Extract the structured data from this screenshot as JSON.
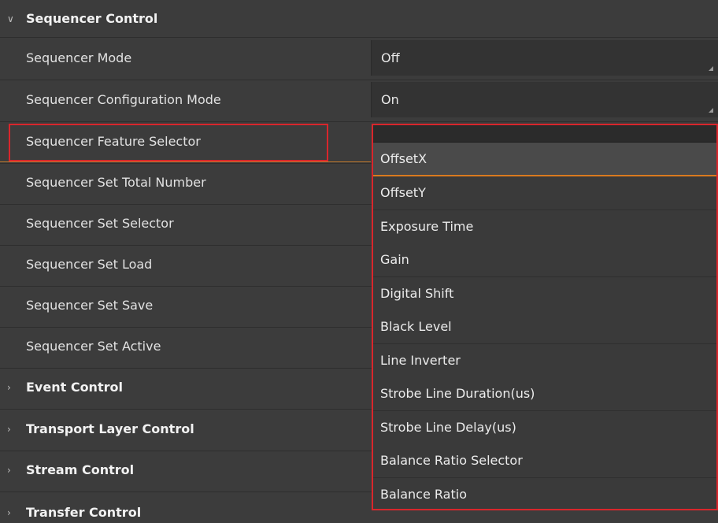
{
  "groups": {
    "sequencer_control": "Sequencer Control",
    "event_control": "Event Control",
    "transport_layer_control": "Transport Layer Control",
    "stream_control": "Stream Control",
    "transfer_control": "Transfer Control"
  },
  "properties": {
    "sequencer_mode": {
      "label": "Sequencer Mode",
      "value": "Off"
    },
    "sequencer_configuration_mode": {
      "label": "Sequencer Configuration Mode",
      "value": "On"
    },
    "sequencer_feature_selector": {
      "label": "Sequencer Feature Selector"
    },
    "sequencer_set_total_number": {
      "label": "Sequencer Set Total Number"
    },
    "sequencer_set_selector": {
      "label": "Sequencer Set Selector"
    },
    "sequencer_set_load": {
      "label": "Sequencer Set Load"
    },
    "sequencer_set_save": {
      "label": "Sequencer Set Save"
    },
    "sequencer_set_active": {
      "label": "Sequencer Set Active"
    }
  },
  "dropdown": {
    "selected": "OffsetX",
    "options": [
      "OffsetX",
      "OffsetY",
      "Exposure Time",
      "Gain",
      "Digital Shift",
      "Black Level",
      "Line Inverter",
      "Strobe Line Duration(us)",
      "Strobe Line Delay(us)",
      "Balance Ratio Selector",
      "Balance Ratio"
    ]
  },
  "icons": {
    "expanded_arrow": "chevron-down-icon",
    "collapsed_arrow": "chevron-right-icon",
    "resize_grip": "resize-grip-icon"
  },
  "colors": {
    "highlight": "#d9262c",
    "selection_underline": "#d97a1f",
    "background": "#3c3c3c"
  }
}
